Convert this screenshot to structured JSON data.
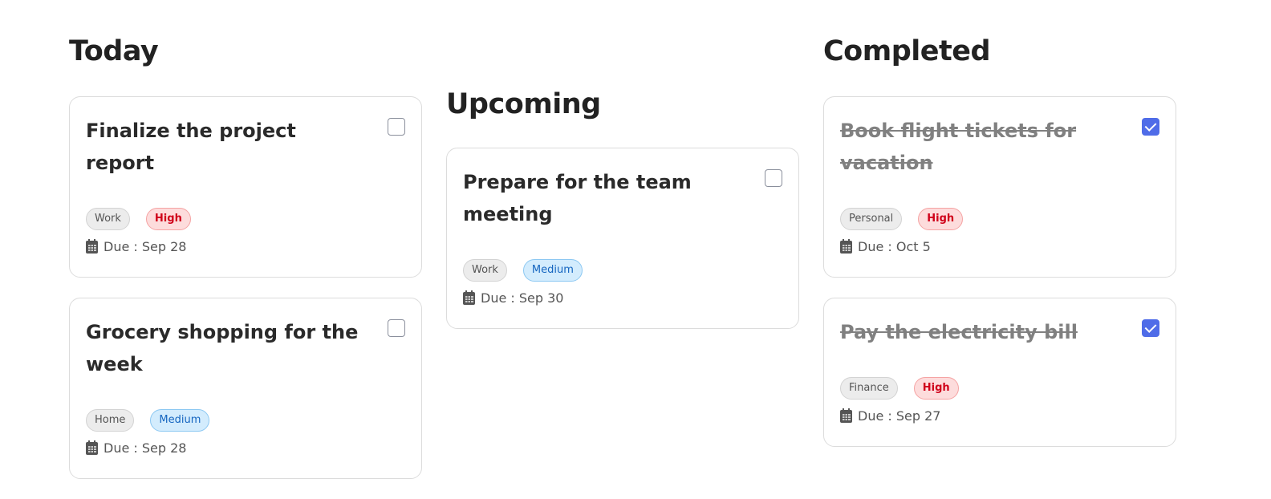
{
  "columns": [
    {
      "title": "Today",
      "tasks": [
        {
          "title": "Finalize the project report",
          "category": "Work",
          "priority": "High",
          "due": "Due : Sep 28",
          "completed": false
        },
        {
          "title": "Grocery shopping for the week",
          "category": "Home",
          "priority": "Medium",
          "due": "Due : Sep 28",
          "completed": false
        }
      ]
    },
    {
      "title": "Upcoming",
      "tasks": [
        {
          "title": "Prepare for the team meeting",
          "category": "Work",
          "priority": "Medium",
          "due": "Due : Sep 30",
          "completed": false
        }
      ]
    },
    {
      "title": "Completed",
      "tasks": [
        {
          "title": "Book flight tickets for vacation",
          "category": "Personal",
          "priority": "High",
          "due": "Due : Oct 5",
          "completed": true
        },
        {
          "title": "Pay the electricity bill",
          "category": "Finance",
          "priority": "High",
          "due": "Due : Sep 27",
          "completed": true
        }
      ]
    }
  ],
  "colors": {
    "accent": "#4f6ce8",
    "high": "#d0021b",
    "medium": "#1565c0"
  }
}
